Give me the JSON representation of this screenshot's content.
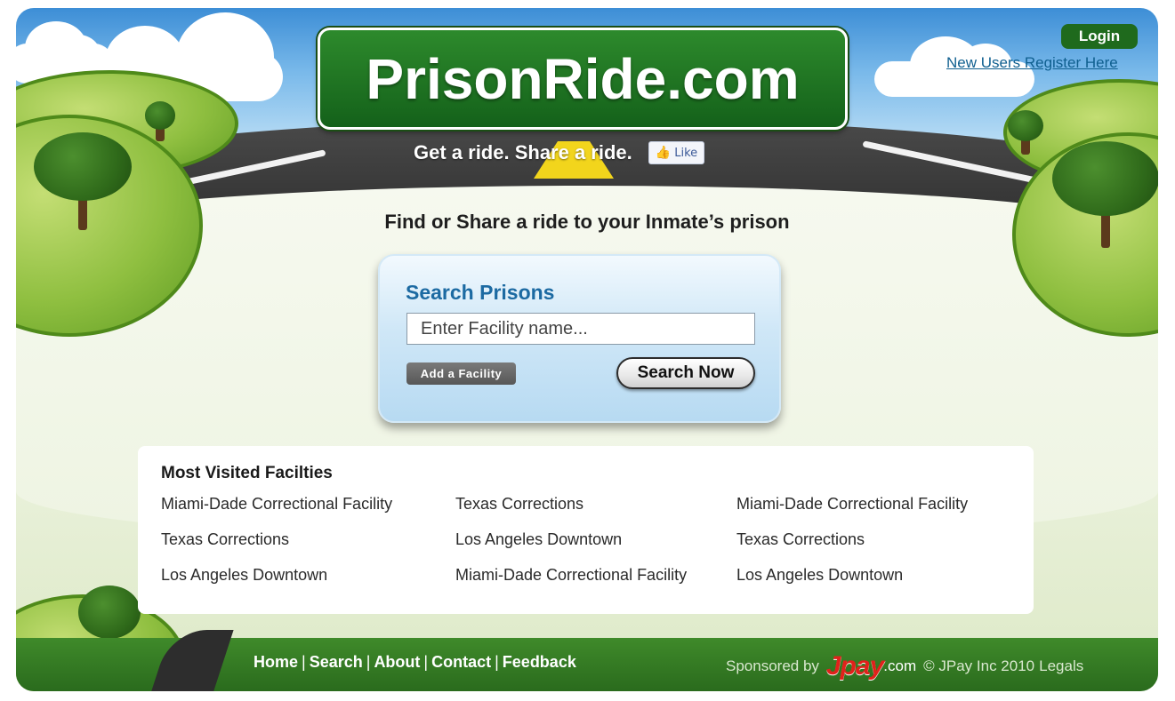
{
  "header": {
    "site_title": "PrisonRide.com",
    "tagline": "Get a ride. Share a ride.",
    "like_label": "Like",
    "login_label": "Login",
    "register_label": "New Users Register Here"
  },
  "headline": "Find or Share a ride to your Inmate’s prison",
  "search": {
    "title": "Search Prisons",
    "placeholder": "Enter Facility name...",
    "add_facility_label": "Add a Facility",
    "search_button_label": "Search Now"
  },
  "most_visited": {
    "title": "Most Visited Facilties",
    "columns": [
      [
        "Miami-Dade Correctional Facility",
        "Texas Corrections",
        "Los Angeles Downtown"
      ],
      [
        "Texas Corrections",
        "Los Angeles Downtown",
        "Miami-Dade Correctional Facility"
      ],
      [
        "Miami-Dade Correctional Facility",
        "Texas Corrections",
        "Los Angeles Downtown"
      ]
    ]
  },
  "footer": {
    "nav": [
      "Home",
      "Search",
      "About",
      "Contact",
      "Feedback"
    ],
    "nav_separator": "|",
    "sponsored_label": "Sponsored by",
    "sponsor_logo": "Jpay",
    "sponsor_domain": ".com",
    "copyright": "© JPay Inc 2010",
    "legals_label": "Legals"
  },
  "colors": {
    "sign_green": "#14611a",
    "search_title_blue": "#1c6aa2",
    "register_link_blue": "#0f5f8f",
    "jpay_red": "#e0221b"
  },
  "icons": {
    "like": "thumbs-up-icon"
  }
}
